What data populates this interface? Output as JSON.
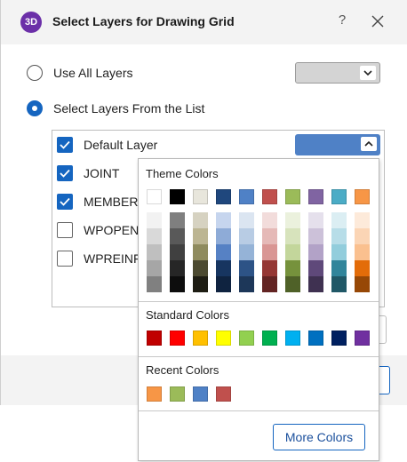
{
  "window": {
    "app_icon_text": "3D",
    "title": "Select Layers for Drawing Grid",
    "help_label": "?"
  },
  "options": {
    "use_all_layers": {
      "label": "Use All Layers",
      "selected": false
    },
    "select_from_list": {
      "label": "Select Layers From the List",
      "selected": true
    }
  },
  "layers": [
    {
      "name": "Default Layer",
      "checked": true,
      "color": "#4f81c6"
    },
    {
      "name": "JOINT",
      "checked": true
    },
    {
      "name": "MEMBER",
      "checked": true
    },
    {
      "name": "WPOPENI",
      "checked": false
    },
    {
      "name": "WPREINFO",
      "checked": false
    }
  ],
  "colors": {
    "accent": "#1565c0",
    "grey_combo": "#d4d4d4"
  },
  "color_picker": {
    "theme_title": "Theme Colors",
    "theme_base": [
      "#ffffff",
      "#000000",
      "#e8e6dc",
      "#1f477d",
      "#4f81c6",
      "#c0504d",
      "#9bbb59",
      "#8064a2",
      "#4bacc6",
      "#f79646"
    ],
    "theme_shades": [
      [
        "#f2f2f2",
        "#d9d9d9",
        "#bfbfbf",
        "#a6a6a6",
        "#808080"
      ],
      [
        "#7f7f7f",
        "#595959",
        "#404040",
        "#262626",
        "#0d0d0d"
      ],
      [
        "#d6d2c1",
        "#bcb592",
        "#8f8b5e",
        "#4c4a30",
        "#1e1d13"
      ],
      [
        "#c6d5ee",
        "#8eabd7",
        "#5681c4",
        "#173560",
        "#0f2340"
      ],
      [
        "#dbe5f1",
        "#b8cce4",
        "#95b3d7",
        "#2d5386",
        "#1d3759"
      ],
      [
        "#f2dcdb",
        "#e5b9b7",
        "#d99694",
        "#953734",
        "#632423"
      ],
      [
        "#ebf1dd",
        "#d7e3bc",
        "#c3d69b",
        "#76923c",
        "#4f6128"
      ],
      [
        "#e5e0ec",
        "#ccc1d9",
        "#b2a2c7",
        "#5f497a",
        "#3f3151"
      ],
      [
        "#dbeef3",
        "#b7dde8",
        "#92cddc",
        "#31859b",
        "#205867"
      ],
      [
        "#fdeada",
        "#fbd5b5",
        "#fac08f",
        "#e36c09",
        "#974806"
      ]
    ],
    "standard_title": "Standard Colors",
    "standard": [
      "#c00000",
      "#ff0000",
      "#ffc000",
      "#ffff00",
      "#92d050",
      "#00b050",
      "#00b0f0",
      "#0070c0",
      "#002060",
      "#7030a0"
    ],
    "recent_title": "Recent Colors",
    "recent": [
      "#f79646",
      "#9bbb59",
      "#4f81c6",
      "#c0504d"
    ],
    "more_colors_label": "More Colors"
  }
}
